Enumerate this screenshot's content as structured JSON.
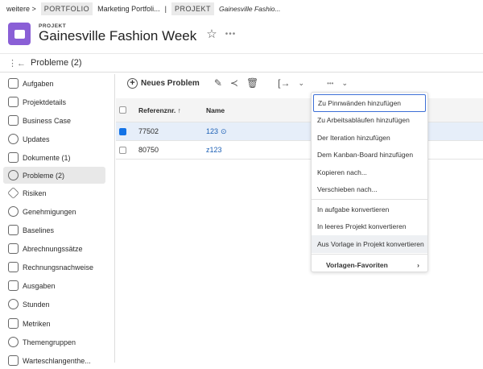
{
  "breadcrumb": {
    "more": "weitere >",
    "portfolio_tag": "PORTFOLIO",
    "portfolio": "Marketing Portfoli...",
    "sep": "|",
    "project_tag": "PROJEKT",
    "project": "Gainesville Fashio..."
  },
  "header": {
    "kicker": "PROJEKT",
    "title": "Gainesville Fashion Week"
  },
  "section": {
    "title": "Probleme (2)"
  },
  "sidebar": {
    "items": [
      {
        "label": "Aufgaben"
      },
      {
        "label": "Projektdetails"
      },
      {
        "label": "Business Case"
      },
      {
        "label": "Updates"
      },
      {
        "label": "Dokumente (1)"
      },
      {
        "label": "Probleme (2)"
      },
      {
        "label": "Risiken"
      },
      {
        "label": "Genehmigungen"
      },
      {
        "label": "Baselines"
      },
      {
        "label": "Abrechnungssätze"
      },
      {
        "label": "Rechnungsnachweise"
      },
      {
        "label": "Ausgaben"
      },
      {
        "label": "Stunden"
      },
      {
        "label": "Metriken"
      },
      {
        "label": "Themengruppen"
      },
      {
        "label": "Warteschlangenthe..."
      }
    ]
  },
  "toolbar": {
    "new_issue": "Neues Problem"
  },
  "table": {
    "headers": [
      "Referenznr. ↑",
      "Name"
    ],
    "rows": [
      {
        "ref": "77502",
        "name": "123",
        "checked": true
      },
      {
        "ref": "80750",
        "name": "z123",
        "checked": false
      }
    ]
  },
  "menu": {
    "items": [
      "Zu Pinnwänden hinzufügen",
      "Zu Arbeitsabläufen hinzufügen",
      "Der Iteration hinzufügen",
      "Dem Kanban-Board hinzufügen",
      "Kopieren nach...",
      "Verschieben nach...",
      "In aufgabe konvertieren",
      "In leeres Projekt konvertieren",
      "Aus Vorlage in Projekt konvertieren"
    ],
    "submenu": "Vorlagen-Favoriten"
  }
}
